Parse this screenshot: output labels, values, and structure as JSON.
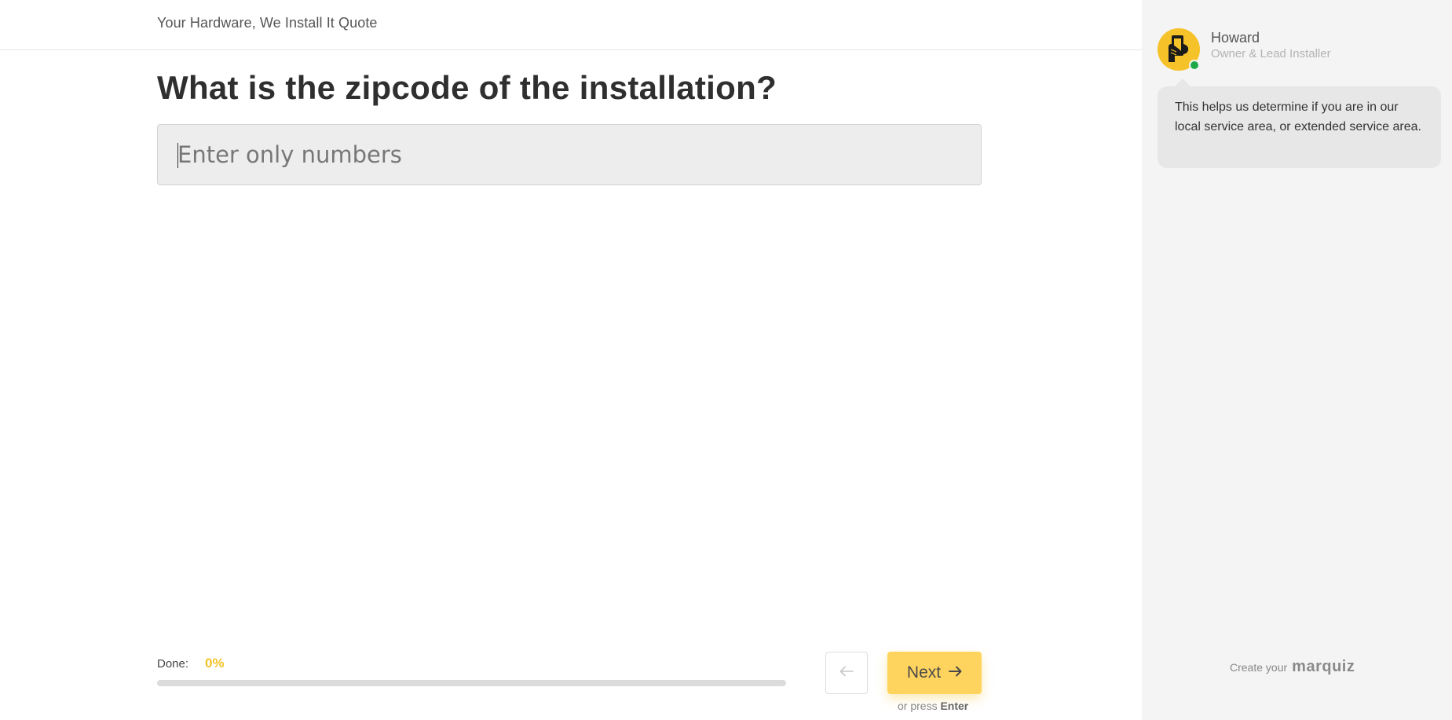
{
  "header": {
    "quiz_title": "Your Hardware, We Install It Quote"
  },
  "question": {
    "text": "What is the zipcode of the installation?",
    "input_value": "",
    "input_placeholder": "Enter only numbers"
  },
  "progress": {
    "label": "Done:",
    "value_text": "0%",
    "fraction": 0
  },
  "navigation": {
    "back_icon": "arrow-left-icon",
    "next_label": "Next",
    "next_icon": "arrow-right-icon",
    "hint_prefix": "or press",
    "hint_key": "Enter"
  },
  "assistant": {
    "name": "Howard",
    "role": "Owner & Lead Installer",
    "avatar_icon": "hand-holding-phone-icon",
    "status": "online",
    "message": "This helps us determine if you are in our local service area, or extended service area."
  },
  "branding": {
    "prefix": "Create your",
    "logo": "marquiz"
  },
  "colors": {
    "accent": "#f5c22a",
    "next_button": "#ffd45e",
    "online": "#1fa84a",
    "side_panel": "#f4f4f4"
  }
}
